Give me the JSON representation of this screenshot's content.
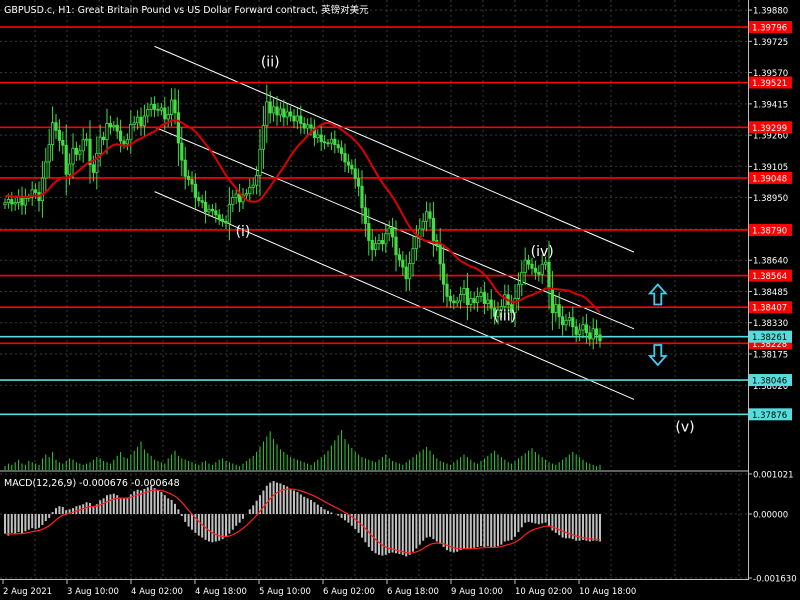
{
  "chart_data": {
    "type": "candlestick",
    "title": "GBPUSD.c, H1:  Great Britain Pound vs US Dollar Forward contract, 英镑对美元",
    "price_axis": {
      "range": [
        1.376,
        1.3992
      ],
      "ticks": [
        "1.39880",
        "1.39725",
        "1.39570",
        "1.39415",
        "1.39260",
        "1.39105",
        "1.38950",
        "1.38795",
        "1.38640",
        "1.38485",
        "1.38330",
        "1.38175",
        "1.38020"
      ]
    },
    "time_axis": {
      "labels": [
        "2 Aug 2021",
        "3 Aug 10:00",
        "4 Aug 02:00",
        "4 Aug 18:00",
        "5 Aug 10:00",
        "6 Aug 02:00",
        "6 Aug 18:00",
        "9 Aug 10:00",
        "10 Aug 02:00",
        "10 Aug 18:00"
      ]
    },
    "horizontal_lines": [
      {
        "price": 1.39796,
        "label": "1.39796",
        "color": "#ff0000"
      },
      {
        "price": 1.39521,
        "label": "1.39521",
        "color": "#ff0000"
      },
      {
        "price": 1.39299,
        "label": "1.39299",
        "color": "#ff0000"
      },
      {
        "price": 1.39048,
        "label": "1.39048",
        "color": "#ff0000"
      },
      {
        "price": 1.3879,
        "label": "1.38790",
        "color": "#ff0000"
      },
      {
        "price": 1.38564,
        "label": "1.38564",
        "color": "#ff0000"
      },
      {
        "price": 1.38407,
        "label": "1.38407",
        "color": "#ff0000"
      },
      {
        "price": 1.38228,
        "label": "1.38228",
        "color": "#ff0000"
      },
      {
        "price": 1.38261,
        "label": "1.38261",
        "color": "#55dddd"
      },
      {
        "price": 1.38046,
        "label": "1.38046",
        "color": "#55dddd"
      },
      {
        "price": 1.37876,
        "label": "1.37876",
        "color": "#55dddd"
      }
    ],
    "wave_labels": [
      {
        "text": "(i)",
        "bar": 70,
        "price": 1.3876
      },
      {
        "text": "(ii)",
        "bar": 78,
        "price": 1.396
      },
      {
        "text": "(iii)",
        "bar": 147,
        "price": 1.3834
      },
      {
        "text": "(iv)",
        "bar": 158,
        "price": 1.3866
      },
      {
        "text": "(v)",
        "bar": 200,
        "price": 1.3779
      }
    ],
    "channel": {
      "upper": [
        {
          "bar": 44,
          "price": 1.397
        },
        {
          "bar": 185,
          "price": 1.3868
        }
      ],
      "middle": [
        {
          "bar": 44,
          "price": 1.393
        },
        {
          "bar": 185,
          "price": 1.383
        }
      ],
      "lower": [
        {
          "bar": 44,
          "price": 1.3898
        },
        {
          "bar": 185,
          "price": 1.3795
        }
      ]
    },
    "moving_average_color": "#dd0000",
    "candle_color": "#44dd44",
    "volume_color": "#33cc33",
    "up_arrow": {
      "bar": 192,
      "price": 1.3847,
      "color": "#44ccee"
    },
    "down_arrow": {
      "bar": 192,
      "price": 1.3817,
      "color": "#44ccee"
    },
    "price_points": [
      1.38925,
      1.38941,
      1.38919,
      1.38926,
      1.38956,
      1.38913,
      1.38947,
      1.38952,
      1.38989,
      1.38976,
      1.38935,
      1.39047,
      1.39127,
      1.39213,
      1.39322,
      1.39284,
      1.39234,
      1.3921,
      1.39066,
      1.39117,
      1.39195,
      1.39165,
      1.39182,
      1.39237,
      1.3924,
      1.39113,
      1.39075,
      1.3917,
      1.3925,
      1.39238,
      1.39318,
      1.39302,
      1.39309,
      1.3928,
      1.39231,
      1.39217,
      1.39237,
      1.39313,
      1.39321,
      1.39349,
      1.39306,
      1.39355,
      1.39387,
      1.39413,
      1.39388,
      1.39384,
      1.39395,
      1.3934,
      1.39362,
      1.39434,
      1.39371,
      1.39221,
      1.39136,
      1.39056,
      1.3904,
      1.39017,
      1.38951,
      1.38935,
      1.38927,
      1.3888,
      1.38892,
      1.38885,
      1.38865,
      1.38843,
      1.38832,
      1.38824,
      1.38917,
      1.38951,
      1.38968,
      1.38929,
      1.38963,
      1.3897,
      1.39001,
      1.39012,
      1.3906,
      1.3919,
      1.39307,
      1.39425,
      1.3937,
      1.394,
      1.3936,
      1.3939,
      1.3935,
      1.39375,
      1.39355,
      1.3933,
      1.39355,
      1.39318,
      1.39295,
      1.39311,
      1.39295,
      1.39248,
      1.39261,
      1.39227,
      1.39222,
      1.3922,
      1.3924,
      1.39213,
      1.39197,
      1.39169,
      1.39127,
      1.39111,
      1.39093,
      1.39045,
      1.39007,
      1.389,
      1.38822,
      1.38738,
      1.38693,
      1.38722,
      1.38738,
      1.38721,
      1.38771,
      1.38799,
      1.38755,
      1.38667,
      1.38641,
      1.38606,
      1.38548,
      1.38623,
      1.38697,
      1.38755,
      1.38795,
      1.38833,
      1.3888,
      1.38848,
      1.38738,
      1.38717,
      1.38622,
      1.38521,
      1.38461,
      1.38438,
      1.38429,
      1.38438,
      1.3847,
      1.385,
      1.3842,
      1.3845,
      1.3843,
      1.3846,
      1.3848,
      1.38425,
      1.38443,
      1.38402,
      1.38362,
      1.38393,
      1.3841,
      1.38469,
      1.3842,
      1.3838,
      1.3845,
      1.3852,
      1.3858,
      1.3864,
      1.3862,
      1.386,
      1.3858,
      1.3857,
      1.3862,
      1.3863,
      1.385,
      1.3838,
      1.3842,
      1.3836,
      1.3832,
      1.38342,
      1.38355,
      1.3831,
      1.38272,
      1.38294,
      1.3832,
      1.3828,
      1.3825,
      1.383,
      1.3827,
      1.3824
    ],
    "volume": [
      3,
      5,
      4,
      6,
      8,
      5,
      4,
      7,
      6,
      5,
      4,
      9,
      12,
      10,
      14,
      8,
      6,
      5,
      7,
      9,
      8,
      6,
      5,
      4,
      5,
      6,
      8,
      10,
      9,
      7,
      6,
      5,
      8,
      11,
      14,
      10,
      9,
      12,
      15,
      18,
      22,
      16,
      13,
      11,
      8,
      7,
      6,
      5,
      9,
      12,
      15,
      11,
      9,
      8,
      7,
      6,
      5,
      4,
      6,
      7,
      5,
      4,
      6,
      8,
      9,
      7,
      6,
      5,
      4,
      3,
      5,
      7,
      9,
      11,
      14,
      18,
      22,
      26,
      30,
      24,
      20,
      16,
      14,
      12,
      10,
      9,
      8,
      7,
      6,
      5,
      4,
      6,
      8,
      10,
      12,
      15,
      19,
      23,
      27,
      31,
      24,
      20,
      17,
      14,
      12,
      10,
      9,
      8,
      7,
      6,
      8,
      10,
      12,
      9,
      7,
      6,
      5,
      4,
      6,
      8,
      10,
      12,
      14,
      16,
      18,
      15,
      12,
      9,
      7,
      6,
      5,
      4,
      6,
      8,
      10,
      12,
      10,
      8,
      6,
      5,
      7,
      9,
      11,
      13,
      15,
      12,
      10,
      8,
      6,
      5,
      7,
      9,
      11,
      13,
      15,
      17,
      14,
      12,
      10,
      8,
      6,
      5,
      4,
      6,
      8,
      10,
      12,
      14,
      12,
      10,
      8,
      6,
      5,
      4,
      3,
      4,
      6,
      8,
      10,
      8,
      6,
      5,
      4,
      6,
      8,
      5,
      4,
      3,
      2,
      2
    ],
    "macd": {
      "title": "MACD(12,26,9) -0.000676 -0.000648",
      "ticks": [
        "0.001021",
        "0.00000",
        "-0.001630"
      ],
      "range": [
        -0.00163,
        0.00102
      ],
      "histogram_color": "#c0c0c0",
      "signal_color": "#ff2020",
      "histogram": [
        -0.0005,
        -0.00055,
        -0.00048,
        -0.00052,
        -0.00046,
        -0.0005,
        -0.00044,
        -0.0004,
        -0.00036,
        -0.00038,
        -0.00035,
        -0.00028,
        -0.00018,
        -0.0001,
        5e-05,
        0.00015,
        0.0002,
        0.00018,
        0.0001,
        0.00012,
        0.00015,
        0.0002,
        0.00022,
        0.00025,
        0.0003,
        0.00028,
        0.0002,
        0.00025,
        0.00035,
        0.0004,
        0.00048,
        0.0005,
        0.00052,
        0.00048,
        0.00042,
        0.0004,
        0.00042,
        0.0005,
        0.00058,
        0.00062,
        0.0006,
        0.00064,
        0.00068,
        0.00072,
        0.00066,
        0.0006,
        0.00056,
        0.00048,
        0.0004,
        0.00036,
        0.00026,
        0.00012,
        -5e-05,
        -0.0002,
        -0.00032,
        -0.0004,
        -0.00048,
        -0.00055,
        -0.0006,
        -0.00066,
        -0.0007,
        -0.00072,
        -0.0007,
        -0.00068,
        -0.00064,
        -0.00058,
        -0.0005,
        -0.0004,
        -0.0003,
        -0.00022,
        -0.00012,
        0.0,
        0.00012,
        0.00022,
        0.00034,
        0.00048,
        0.0006,
        0.00072,
        0.0008,
        0.00084,
        0.0008,
        0.00078,
        0.00074,
        0.0007,
        0.00064,
        0.0006,
        0.00056,
        0.0005,
        0.00044,
        0.0004,
        0.00036,
        0.0003,
        0.00024,
        0.00018,
        0.00012,
        8e-05,
        4e-05,
        0.0,
        -4e-05,
        -0.0001,
        -0.00016,
        -0.00022,
        -0.0003,
        -0.00038,
        -0.00048,
        -0.0006,
        -0.00072,
        -0.00084,
        -0.00094,
        -0.001,
        -0.00104,
        -0.00106,
        -0.00104,
        -0.001,
        -0.00098,
        -0.001,
        -0.00102,
        -0.00104,
        -0.00108,
        -0.00104,
        -0.00096,
        -0.00088,
        -0.00078,
        -0.00068,
        -0.0006,
        -0.00058,
        -0.00064,
        -0.0007,
        -0.00076,
        -0.00084,
        -0.00092,
        -0.00096,
        -0.00098,
        -0.00096,
        -0.00092,
        -0.00088,
        -0.0009,
        -0.00088,
        -0.00086,
        -0.00084,
        -0.00082,
        -0.00084,
        -0.00082,
        -0.00084,
        -0.00086,
        -0.00082,
        -0.00078,
        -0.0007,
        -0.00068,
        -0.00066,
        -0.00058,
        -0.00046,
        -0.00034,
        -0.00022,
        -0.0002,
        -0.00022,
        -0.00024,
        -0.00026,
        -0.00024,
        -0.00022,
        -0.0003,
        -0.00042,
        -0.00048,
        -0.00054,
        -0.0006,
        -0.00062,
        -0.00062,
        -0.00064,
        -0.00068,
        -0.00068,
        -0.00066,
        -0.00068,
        -0.0007,
        -0.00068,
        -0.00068,
        -0.0007
      ]
    }
  }
}
